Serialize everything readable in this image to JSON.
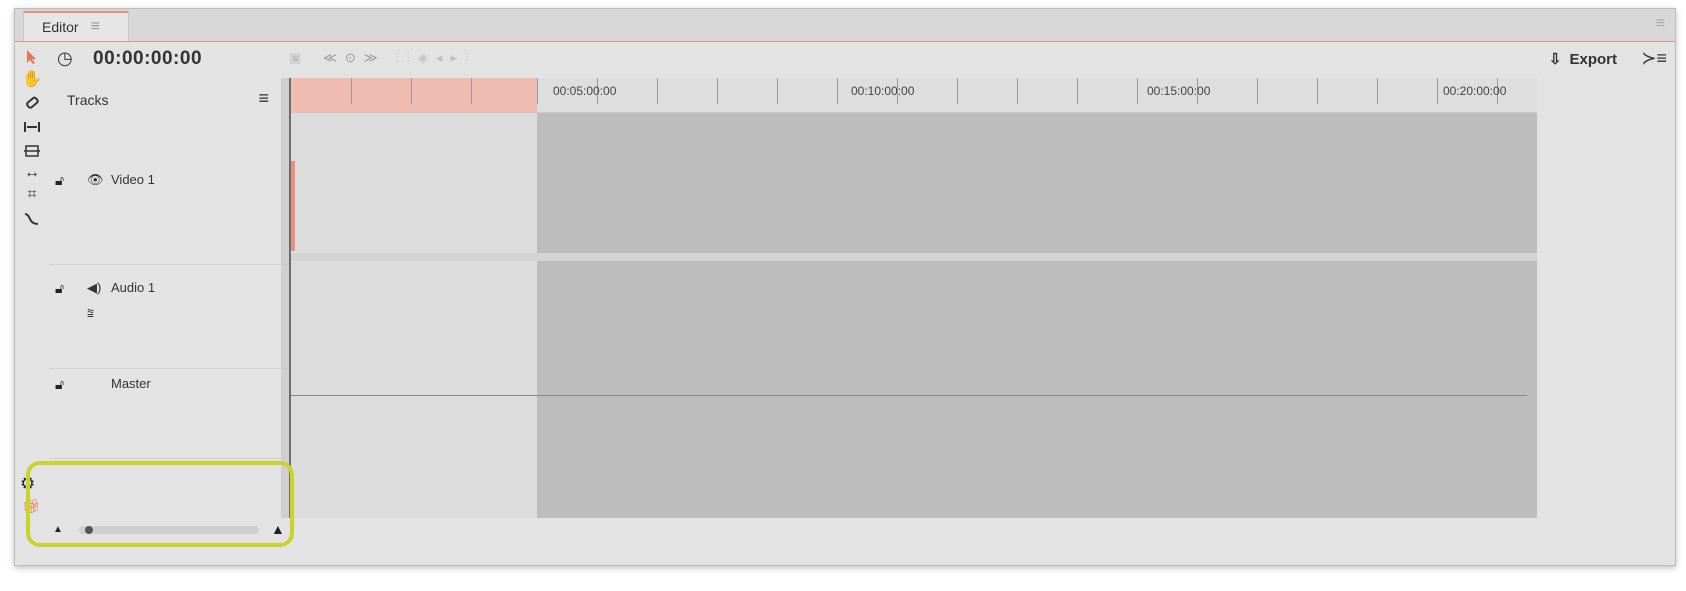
{
  "tabs": [
    {
      "label": "Editor"
    }
  ],
  "header": {
    "timecode": "00:00:00:00",
    "export_label": "Export"
  },
  "tracks_panel": {
    "title": "Tracks",
    "tracks": [
      {
        "name": "Video 1",
        "type": "video"
      },
      {
        "name": "Audio 1",
        "type": "audio"
      },
      {
        "name": "Master",
        "type": "master"
      }
    ]
  },
  "ruler": {
    "labels": [
      "00:05:00:00",
      "00:10:00:00",
      "00:15:00:00",
      "00:20:00:00"
    ]
  },
  "colors": {
    "accent": "#e8907f",
    "selection": "#f0bcb2",
    "highlight": "#c8d42a",
    "timeline_empty": "#bdbdbd"
  },
  "icons": {
    "tools": [
      "pointer-icon",
      "hand-icon",
      "eraser-icon",
      "trim-icon",
      "split-icon",
      "stretch-icon",
      "razor-icon",
      "curve-icon"
    ],
    "transport": [
      "rewind-icon",
      "record-icon",
      "fast-forward-icon"
    ],
    "bottom": [
      "zoom-out-icon",
      "zoom-in-icon",
      "settings-icon",
      "gift-icon"
    ]
  }
}
